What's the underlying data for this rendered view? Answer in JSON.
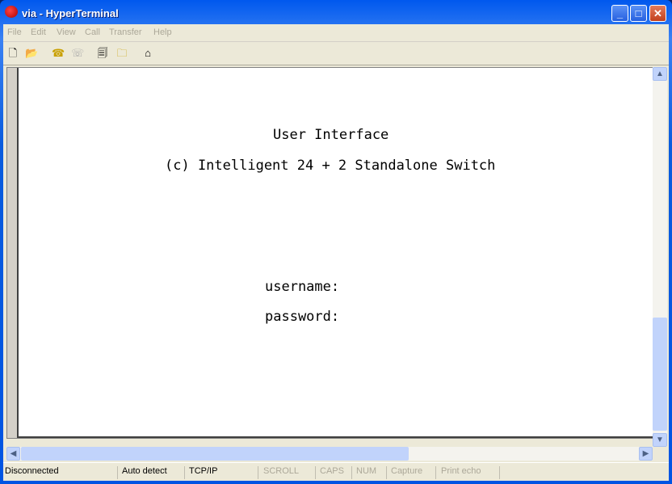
{
  "window": {
    "title": "via - HyperTerminal"
  },
  "menu": [
    "File",
    "Edit",
    "View",
    "Call",
    "Transfer",
    "Help"
  ],
  "toolbar": [
    {
      "icon": "new-document-icon"
    },
    {
      "icon": "open-folder-icon"
    },
    {
      "icon": "call-phone-icon"
    },
    {
      "icon": "disconnect-phone-icon"
    },
    {
      "icon": "send-file-icon"
    },
    {
      "icon": "receive-file-icon"
    },
    {
      "icon": "properties-icon"
    }
  ],
  "terminal": {
    "line1": "User Interface",
    "line2": "(c) Intelligent 24 + 2 Standalone Switch",
    "username_label": "username:",
    "password_label": "password:"
  },
  "status": {
    "connection": "Disconnected",
    "detect": "Auto detect",
    "protocol": "TCP/IP",
    "scroll": "SCROLL",
    "caps": "CAPS",
    "num": "NUM",
    "capture": "Capture",
    "print_echo": "Print echo"
  }
}
